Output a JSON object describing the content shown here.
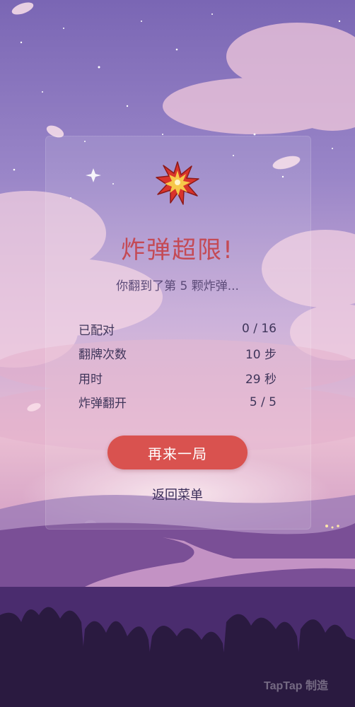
{
  "result": {
    "title": "炸弹超限!",
    "subtitle": "你翻到了第 5 颗炸弹..."
  },
  "stats": [
    {
      "label": "已配对",
      "value": "0 / 16"
    },
    {
      "label": "翻牌次数",
      "value": "10 步"
    },
    {
      "label": "用时",
      "value": "29 秒"
    },
    {
      "label": "炸弹翻开",
      "value": "5 / 5"
    }
  ],
  "actions": {
    "retry_label": "再来一局",
    "menu_label": "返回菜单"
  },
  "watermark": "TapTap 制造",
  "colors": {
    "title": "#c44a55",
    "button": "#d9524f",
    "sky_top": "#7b6bb8",
    "sky_bottom": "#e8b8d0"
  },
  "icons": [
    "explosion-icon"
  ]
}
